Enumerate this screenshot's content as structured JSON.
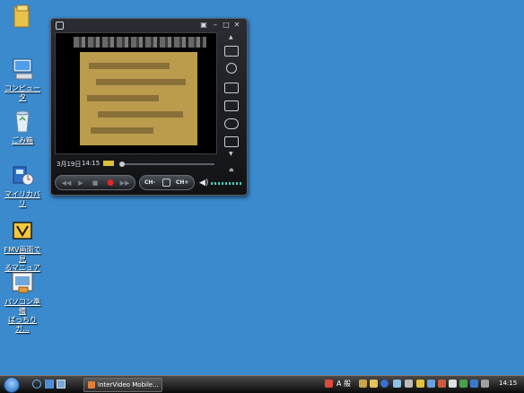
{
  "desktop_icons": [
    {
      "label": "",
      "icon": "folder-icon"
    },
    {
      "label": "コンピュータ",
      "icon": "computer-icon"
    },
    {
      "label": "ごみ箱",
      "icon": "recycle-bin-icon"
    },
    {
      "label": "マイリカバリ",
      "icon": "recovery-icon"
    },
    {
      "label": "FMV画面で見\nるマニュアル",
      "icon": "manual-icon"
    },
    {
      "label": "パソコン準備\nばっちりガ...",
      "icon": "setup-guide-icon"
    }
  ],
  "player": {
    "status_date": "3月19日",
    "status_time": "14:15",
    "ch_minus_label": "CH-",
    "ch_plus_label": "CH+"
  },
  "taskbar": {
    "task_label": "InterVideo Mobile...",
    "clock": "14:15",
    "ime_label": "A 般"
  },
  "colors": {
    "desktop": "#3a8acd",
    "taskbar": "#1a1a1a",
    "video_image": "#bb9c4d"
  }
}
